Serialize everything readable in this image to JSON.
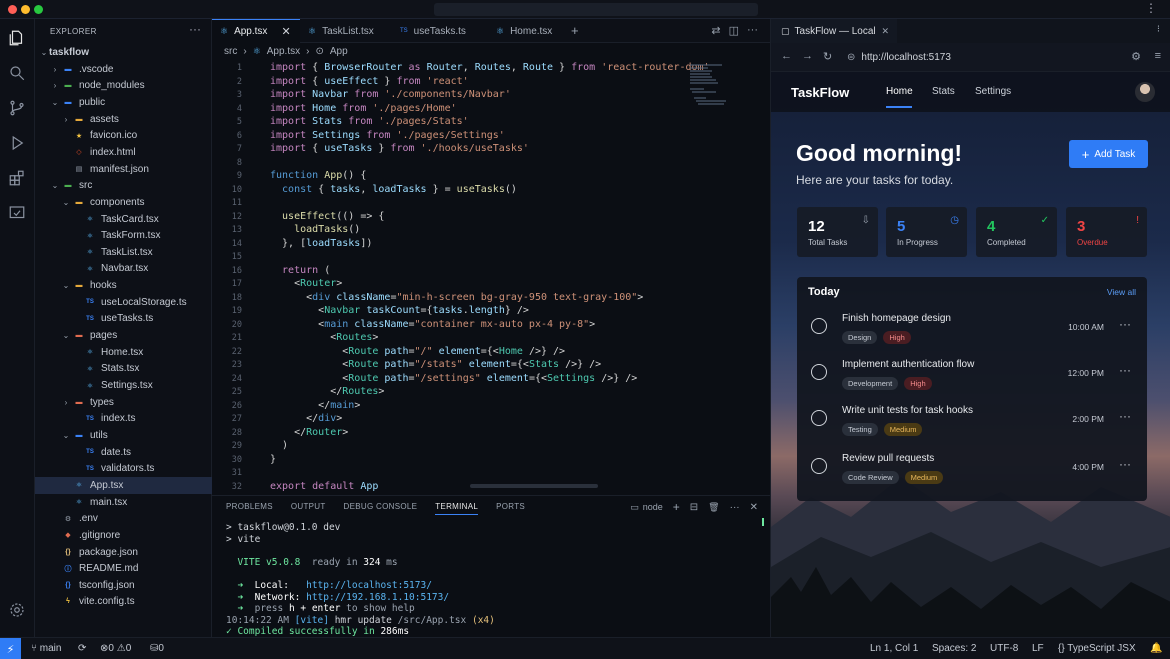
{
  "colors": {
    "accent": "#3b82f6",
    "close": "#ff5f57",
    "minimize": "#febc2e",
    "maximize": "#28c840",
    "high": "#f38a8a",
    "medium": "#e8b75a",
    "in_progress": "#3b82f6",
    "completed": "#22c55e",
    "overdue": "#ef4444"
  },
  "explorer": {
    "header": "EXPLORER",
    "more": "···"
  },
  "tree": [
    {
      "label": "taskflow",
      "chev": "⌄",
      "icon": "",
      "iconColor": "",
      "bold": true
    },
    {
      "label": ".vscode",
      "chev": "›",
      "icon": "folder-icon",
      "iconColor": "#3b82f6"
    },
    {
      "label": "node_modules",
      "chev": "›",
      "icon": "folder-icon",
      "iconColor": "#4caf50"
    },
    {
      "label": "public",
      "chev": "⌄",
      "icon": "folder-icon",
      "iconColor": "#3b82f6"
    },
    {
      "label": "assets",
      "chev": "›",
      "icon": "folder-icon",
      "iconColor": "#e5a93b"
    },
    {
      "label": "favicon.ico",
      "chev": "",
      "icon": "star-icon",
      "iconColor": "#f5c542"
    },
    {
      "label": "index.html",
      "chev": "",
      "icon": "html-icon",
      "iconColor": "#e44d26"
    },
    {
      "label": "manifest.json",
      "chev": "",
      "icon": "file-icon",
      "iconColor": "#9aa3af"
    },
    {
      "label": "src",
      "chev": "⌄",
      "icon": "folder-icon",
      "iconColor": "#4caf50"
    },
    {
      "label": "components",
      "chev": "⌄",
      "icon": "folder-icon",
      "iconColor": "#e5a93b"
    },
    {
      "label": "TaskCard.tsx",
      "chev": "",
      "icon": "react-icon",
      "iconColor": "#5ab4f0"
    },
    {
      "label": "TaskForm.tsx",
      "chev": "",
      "icon": "react-icon",
      "iconColor": "#5ab4f0"
    },
    {
      "label": "TaskList.tsx",
      "chev": "",
      "icon": "react-icon",
      "iconColor": "#5ab4f0"
    },
    {
      "label": "Navbar.tsx",
      "chev": "",
      "icon": "react-icon",
      "iconColor": "#5ab4f0"
    },
    {
      "label": "hooks",
      "chev": "⌄",
      "icon": "folder-icon",
      "iconColor": "#e5a93b"
    },
    {
      "label": "useLocalStorage.ts",
      "chev": "",
      "icon": "ts-icon",
      "iconColor": "#3b82f6"
    },
    {
      "label": "useTasks.ts",
      "chev": "",
      "icon": "ts-icon",
      "iconColor": "#3b82f6"
    },
    {
      "label": "pages",
      "chev": "⌄",
      "icon": "folder-icon",
      "iconColor": "#e06c50"
    },
    {
      "label": "Home.tsx",
      "chev": "",
      "icon": "react-icon",
      "iconColor": "#5ab4f0"
    },
    {
      "label": "Stats.tsx",
      "chev": "",
      "icon": "react-icon",
      "iconColor": "#5ab4f0"
    },
    {
      "label": "Settings.tsx",
      "chev": "",
      "icon": "react-icon",
      "iconColor": "#5ab4f0"
    },
    {
      "label": "types",
      "chev": "›",
      "icon": "folder-icon",
      "iconColor": "#e06c50"
    },
    {
      "label": "index.ts",
      "chev": "",
      "icon": "ts-icon",
      "iconColor": "#3b82f6"
    },
    {
      "label": "utils",
      "chev": "⌄",
      "icon": "folder-icon",
      "iconColor": "#3b82f6"
    },
    {
      "label": "date.ts",
      "chev": "",
      "icon": "ts-icon",
      "iconColor": "#3b82f6"
    },
    {
      "label": "validators.ts",
      "chev": "",
      "icon": "ts-icon",
      "iconColor": "#3b82f6"
    },
    {
      "label": "App.tsx",
      "chev": "",
      "icon": "react-icon",
      "iconColor": "#5ab4f0",
      "selected": true
    },
    {
      "label": "main.tsx",
      "chev": "",
      "icon": "react-icon",
      "iconColor": "#5ab4f0"
    },
    {
      "label": ".env",
      "chev": "",
      "icon": "settings-file-icon",
      "iconColor": "#9aa3af"
    },
    {
      "label": ".gitignore",
      "chev": "",
      "icon": "git-icon",
      "iconColor": "#e06c50"
    },
    {
      "label": "package.json",
      "chev": "",
      "icon": "json-icon",
      "iconColor": "#e5c07b"
    },
    {
      "label": "README.md",
      "chev": "",
      "icon": "info-icon",
      "iconColor": "#3b82f6"
    },
    {
      "label": "tsconfig.json",
      "chev": "",
      "icon": "json-icon",
      "iconColor": "#3b82f6"
    },
    {
      "label": "vite.config.ts",
      "chev": "",
      "icon": "vite-icon",
      "iconColor": "#f5c542"
    }
  ],
  "tabs": [
    {
      "label": "App.tsx",
      "close": "✕",
      "active": true
    },
    {
      "label": "TaskList.tsx"
    },
    {
      "label": "useTasks.ts"
    },
    {
      "label": "Home.tsx"
    }
  ],
  "tab_add": "+",
  "breadcrumb": {
    "folder": "src",
    "sep1": "›",
    "file": "App.tsx",
    "sep2": "›",
    "symbol": "App"
  },
  "code": [
    [
      [
        "kw",
        "import"
      ],
      [
        "pn",
        " { "
      ],
      [
        "va",
        "BrowserRouter"
      ],
      [
        "kw",
        " as "
      ],
      [
        "va",
        "Router"
      ],
      [
        "pn",
        ", "
      ],
      [
        "va",
        "Routes"
      ],
      [
        "pn",
        ", "
      ],
      [
        "va",
        "Route"
      ],
      [
        "pn",
        " } "
      ],
      [
        "kw",
        "from"
      ],
      [
        "st",
        " 'react-router-dom'"
      ]
    ],
    [
      [
        "kw",
        "import"
      ],
      [
        "pn",
        " { "
      ],
      [
        "va",
        "useEffect"
      ],
      [
        "pn",
        " } "
      ],
      [
        "kw",
        "from"
      ],
      [
        "st",
        " 'react'"
      ]
    ],
    [
      [
        "kw",
        "import"
      ],
      [
        "va",
        " Navbar"
      ],
      [
        "kw",
        " from"
      ],
      [
        "st",
        " './components/Navbar'"
      ]
    ],
    [
      [
        "kw",
        "import"
      ],
      [
        "va",
        " Home"
      ],
      [
        "kw",
        " from"
      ],
      [
        "st",
        " './pages/Home'"
      ]
    ],
    [
      [
        "kw",
        "import"
      ],
      [
        "va",
        " Stats"
      ],
      [
        "kw",
        " from"
      ],
      [
        "st",
        " './pages/Stats'"
      ]
    ],
    [
      [
        "kw",
        "import"
      ],
      [
        "va",
        " Settings"
      ],
      [
        "kw",
        " from"
      ],
      [
        "st",
        " './pages/Settings'"
      ]
    ],
    [
      [
        "kw",
        "import"
      ],
      [
        "pn",
        " { "
      ],
      [
        "va",
        "useTasks"
      ],
      [
        "pn",
        " } "
      ],
      [
        "kw",
        "from"
      ],
      [
        "st",
        " './hooks/useTasks'"
      ]
    ],
    [],
    [
      [
        "kb",
        "function"
      ],
      [
        "fn",
        " App"
      ],
      [
        "pn",
        "() {"
      ]
    ],
    [
      [
        "kb",
        "  const"
      ],
      [
        "pn",
        " { "
      ],
      [
        "va",
        "tasks"
      ],
      [
        "pn",
        ", "
      ],
      [
        "va",
        "loadTasks"
      ],
      [
        "pn",
        " } = "
      ],
      [
        "fn",
        "useTasks"
      ],
      [
        "pn",
        "()"
      ]
    ],
    [],
    [
      [
        "fn",
        "  useEffect"
      ],
      [
        "pn",
        "(() => {"
      ]
    ],
    [
      [
        "fn",
        "    loadTasks"
      ],
      [
        "pn",
        "()"
      ]
    ],
    [
      [
        "pn",
        "  }, ["
      ],
      [
        "va",
        "loadTasks"
      ],
      [
        "pn",
        "])"
      ]
    ],
    [],
    [
      [
        "kw",
        "  return"
      ],
      [
        "pn",
        " ("
      ]
    ],
    [
      [
        "pn",
        "    <"
      ],
      [
        "tg",
        "Router"
      ],
      [
        "pn",
        ">"
      ]
    ],
    [
      [
        "pn",
        "      <"
      ],
      [
        "tgb",
        "div"
      ],
      [
        "at",
        " className"
      ],
      [
        "pn",
        "="
      ],
      [
        "st",
        "\"min-h-screen bg-gray-950 text-gray-100\""
      ],
      [
        "pn",
        ">"
      ]
    ],
    [
      [
        "pn",
        "        <"
      ],
      [
        "tg",
        "Navbar"
      ],
      [
        "at",
        " taskCount"
      ],
      [
        "pn",
        "={"
      ],
      [
        "va",
        "tasks"
      ],
      [
        "pn",
        "."
      ],
      [
        "va",
        "length"
      ],
      [
        "pn",
        "} />"
      ]
    ],
    [
      [
        "pn",
        "        <"
      ],
      [
        "tgb",
        "main"
      ],
      [
        "at",
        " className"
      ],
      [
        "pn",
        "="
      ],
      [
        "st",
        "\"container mx-auto px-4 py-8\""
      ],
      [
        "pn",
        ">"
      ]
    ],
    [
      [
        "pn",
        "          <"
      ],
      [
        "tg",
        "Routes"
      ],
      [
        "pn",
        ">"
      ]
    ],
    [
      [
        "pn",
        "            <"
      ],
      [
        "tg",
        "Route"
      ],
      [
        "at",
        " path"
      ],
      [
        "pn",
        "="
      ],
      [
        "st",
        "\"/\""
      ],
      [
        "at",
        " element"
      ],
      [
        "pn",
        "={<"
      ],
      [
        "tg",
        "Home"
      ],
      [
        "pn",
        " />} />"
      ]
    ],
    [
      [
        "pn",
        "            <"
      ],
      [
        "tg",
        "Route"
      ],
      [
        "at",
        " path"
      ],
      [
        "pn",
        "="
      ],
      [
        "st",
        "\"/stats\""
      ],
      [
        "at",
        " element"
      ],
      [
        "pn",
        "={<"
      ],
      [
        "tg",
        "Stats"
      ],
      [
        "pn",
        " />} />"
      ]
    ],
    [
      [
        "pn",
        "            <"
      ],
      [
        "tg",
        "Route"
      ],
      [
        "at",
        " path"
      ],
      [
        "pn",
        "="
      ],
      [
        "st",
        "\"/settings\""
      ],
      [
        "at",
        " element"
      ],
      [
        "pn",
        "={<"
      ],
      [
        "tg",
        "Settings"
      ],
      [
        "pn",
        " />} />"
      ]
    ],
    [
      [
        "pn",
        "          </"
      ],
      [
        "tg",
        "Routes"
      ],
      [
        "pn",
        ">"
      ]
    ],
    [
      [
        "pn",
        "        </"
      ],
      [
        "tgb",
        "main"
      ],
      [
        "pn",
        ">"
      ]
    ],
    [
      [
        "pn",
        "      </"
      ],
      [
        "tgb",
        "div"
      ],
      [
        "pn",
        ">"
      ]
    ],
    [
      [
        "pn",
        "    </"
      ],
      [
        "tg",
        "Router"
      ],
      [
        "pn",
        ">"
      ]
    ],
    [
      [
        "pn",
        "  )"
      ]
    ],
    [
      [
        "pn",
        "}"
      ]
    ],
    [],
    [
      [
        "kw",
        "export"
      ],
      [
        "kw",
        " default"
      ],
      [
        "va",
        " App"
      ]
    ]
  ],
  "panel": {
    "tabs": [
      "PROBLEMS",
      "OUTPUT",
      "DEBUG CONSOLE",
      "TERMINAL",
      "PORTS"
    ],
    "active": "TERMINAL",
    "shell": "node",
    "plus": "+",
    "split": "⊟",
    "trash": "🗑",
    "more": "···",
    "close": "✕"
  },
  "terminal": [
    [
      [
        "#d0d4da",
        "> taskflow@0.1.0 dev"
      ]
    ],
    [
      [
        "#d0d4da",
        "> vite"
      ]
    ],
    [],
    [
      [
        "#6ee7a0",
        "  VITE v5.0.8"
      ],
      [
        "#9aa3af",
        "  ready in "
      ],
      [
        "#ffffff",
        "324"
      ],
      [
        "#9aa3af",
        " ms"
      ]
    ],
    [],
    [
      [
        "#6ee7a0",
        "  ➜  "
      ],
      [
        "#ffffff",
        "Local:   "
      ],
      [
        "#5ab4f0",
        "http://localhost:5173/"
      ]
    ],
    [
      [
        "#6ee7a0",
        "  ➜  "
      ],
      [
        "#ffffff",
        "Network: "
      ],
      [
        "#5ab4f0",
        "http://192.168.1.10:5173/"
      ]
    ],
    [
      [
        "#6ee7a0",
        "  ➜  "
      ],
      [
        "#9aa3af",
        "press "
      ],
      [
        "#ffffff",
        "h + enter"
      ],
      [
        "#9aa3af",
        " to show help"
      ]
    ],
    [
      [
        "#9aa3af",
        "10:14:22 AM "
      ],
      [
        "#5ab4f0",
        "[vite]"
      ],
      [
        "#d0d4da",
        " hmr update "
      ],
      [
        "#9aa3af",
        "/src/App.tsx"
      ],
      [
        "#e5c07b",
        " (x4)"
      ]
    ],
    [
      [
        "#6ee7a0",
        "✓ Compiled successfully in "
      ],
      [
        "#ffffff",
        "286ms"
      ]
    ]
  ],
  "browser": {
    "tab_title": "TaskFlow — Local",
    "tab_close": "✕",
    "url": "http://localhost:5173"
  },
  "taskflow": {
    "brand": "TaskFlow",
    "nav": [
      "Home",
      "Stats",
      "Settings"
    ],
    "greeting": "Good morning!",
    "subtitle": "Here are your tasks for today.",
    "add_button": "Add Task",
    "stats": [
      {
        "value": "12",
        "label": "Total Tasks",
        "color": "#ffffff",
        "labelColor": "#c5cad3",
        "icon": "inbox-icon",
        "glyph": "⇩",
        "iconColor": "#9aa3af"
      },
      {
        "value": "5",
        "label": "In Progress",
        "color": "#3b82f6",
        "labelColor": "#c5cad3",
        "icon": "clock-icon",
        "glyph": "◷",
        "iconColor": "#3b82f6"
      },
      {
        "value": "4",
        "label": "Completed",
        "color": "#22c55e",
        "labelColor": "#c5cad3",
        "icon": "check-circle-icon",
        "glyph": "✓",
        "iconColor": "#22c55e"
      },
      {
        "value": "3",
        "label": "Overdue",
        "color": "#ef4444",
        "labelColor": "#ef4444",
        "icon": "alert-icon",
        "glyph": "!",
        "iconColor": "#ef4444"
      }
    ],
    "today": {
      "title": "Today",
      "view_all": "View all"
    },
    "tasks": [
      {
        "title": "Finish homepage design",
        "tags": [
          {
            "t": "Design",
            "k": ""
          },
          {
            "t": "High",
            "k": "hi"
          }
        ],
        "time": "10:00 AM"
      },
      {
        "title": "Implement authentication flow",
        "tags": [
          {
            "t": "Development",
            "k": ""
          },
          {
            "t": "High",
            "k": "hi"
          }
        ],
        "time": "12:00 PM"
      },
      {
        "title": "Write unit tests for task hooks",
        "tags": [
          {
            "t": "Testing",
            "k": ""
          },
          {
            "t": "Medium",
            "k": "md"
          }
        ],
        "time": "2:00 PM"
      },
      {
        "title": "Review pull requests",
        "tags": [
          {
            "t": "Code Review",
            "k": ""
          },
          {
            "t": "Medium",
            "k": "md"
          }
        ],
        "time": "4:00 PM"
      }
    ]
  },
  "statusbar": {
    "branch": "main",
    "errors": "0",
    "warnings": "0",
    "ports": "0",
    "position": "Ln 1, Col 1",
    "spaces": "Spaces: 2",
    "encoding": "UTF-8",
    "eol": "LF",
    "language": "TypeScript JSX"
  }
}
